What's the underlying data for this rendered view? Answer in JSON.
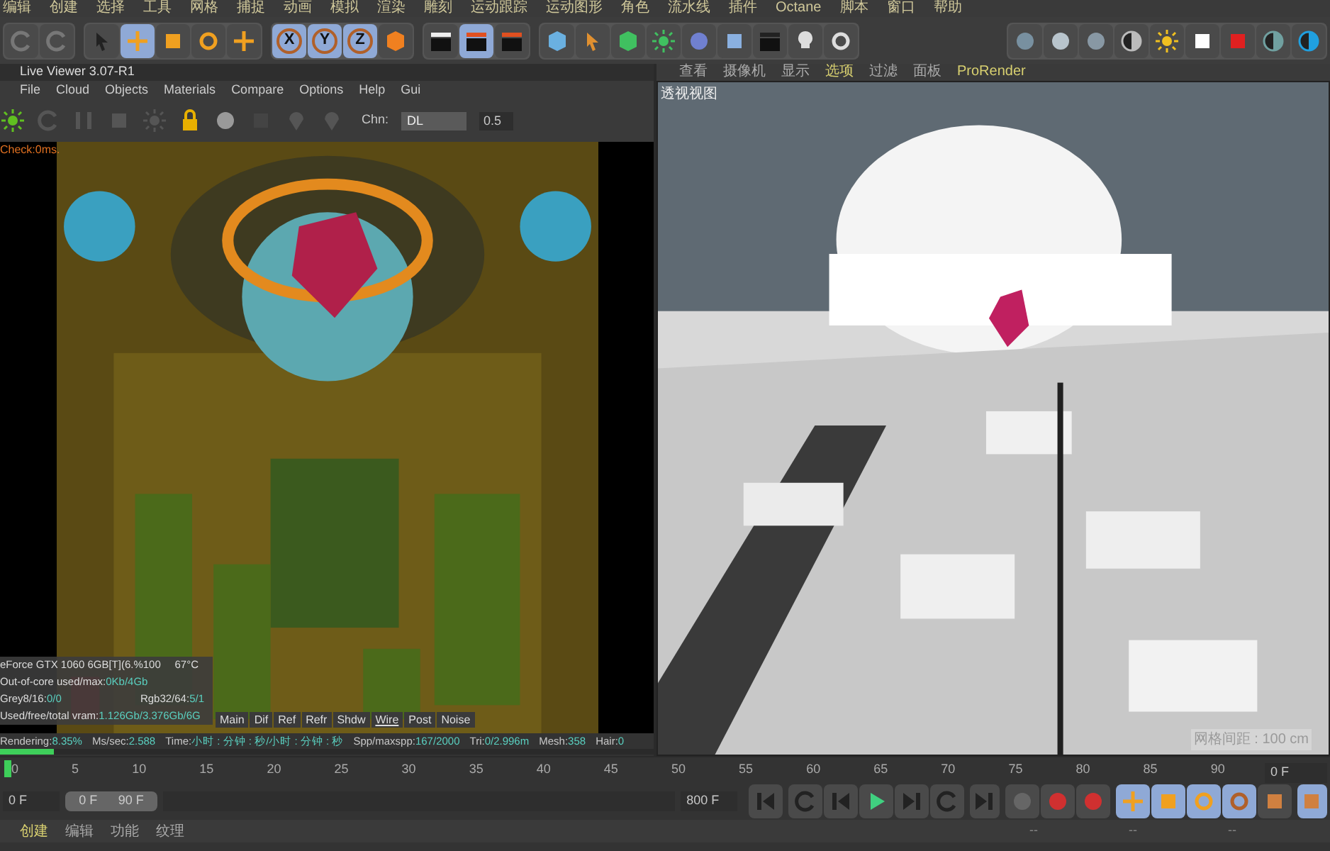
{
  "menu_bar": [
    "编辑",
    "创建",
    "选择",
    "工具",
    "网格",
    "捕捉",
    "动画",
    "模拟",
    "渲染",
    "雕刻",
    "运动跟踪",
    "运动图形",
    "角色",
    "流水线",
    "插件",
    "Octane",
    "脚本",
    "窗口",
    "帮助"
  ],
  "tools": [
    {
      "selected": false
    },
    {
      "selected": true
    },
    {
      "selected": false
    },
    {
      "selected": false
    },
    {
      "selected": false
    }
  ],
  "axis_locks": [
    {
      "label": "X",
      "selected": true
    },
    {
      "label": "Y",
      "selected": true
    },
    {
      "label": "Z",
      "selected": true
    }
  ],
  "live_viewer": {
    "title": "Live Viewer 3.07-R1",
    "menu": [
      "File",
      "Cloud",
      "Objects",
      "Materials",
      "Compare",
      "Options",
      "Help",
      "Gui"
    ],
    "channel_label": "Chn:",
    "channel": "DL",
    "value": "0.5",
    "check": "Check:0ms.",
    "stats": [
      {
        "left": "eForce GTX 1060 6GB[T](6.%100",
        "right": "67°C"
      },
      {
        "left": "Out-of-core used/max:",
        "value": "0Kb/4Gb"
      },
      {
        "left": "Grey8/16: ",
        "value": "0/0",
        "right": "Rgb32/64: ",
        "right_value": "5/1"
      },
      {
        "left": "Used/free/total vram: ",
        "value": "1.126Gb/3.376Gb/6G"
      }
    ],
    "passes": [
      {
        "label": "Main",
        "selected": false
      },
      {
        "label": "Dif",
        "selected": false
      },
      {
        "label": "Ref",
        "selected": false
      },
      {
        "label": "Refr",
        "selected": false
      },
      {
        "label": "Shdw",
        "selected": false
      },
      {
        "label": "Wire",
        "selected": true
      },
      {
        "label": "Post",
        "selected": false
      },
      {
        "label": "Noise",
        "selected": false
      }
    ],
    "status": [
      {
        "label": "Rendering: ",
        "value": "8.35%"
      },
      {
        "label": "Ms/sec: ",
        "value": "2.588"
      },
      {
        "label": "Time: ",
        "value": "小时 : 分钟 : 秒/小时 : 分钟 : 秒"
      },
      {
        "label": "Spp/maxspp: ",
        "value": "167/2000"
      },
      {
        "label": "Tri: ",
        "value": "0/2.996m"
      },
      {
        "label": "Mesh: ",
        "value": "358"
      },
      {
        "label": "Hair: ",
        "value": "0"
      }
    ],
    "progress": {
      "level": 0.0835
    }
  },
  "viewport": {
    "menu": [
      {
        "label": "查看",
        "selected": false
      },
      {
        "label": "摄像机",
        "selected": false
      },
      {
        "label": "显示",
        "selected": false
      },
      {
        "label": "选项",
        "selected": true
      },
      {
        "label": "过滤",
        "selected": false
      },
      {
        "label": "面板",
        "selected": false
      },
      {
        "label": "ProRender",
        "selected": true
      }
    ],
    "label": "透视视图",
    "grid_spacing": "网格间距 : 100 cm"
  },
  "timeline": {
    "ticks": [
      "0",
      "5",
      "10",
      "15",
      "20",
      "25",
      "30",
      "35",
      "40",
      "45",
      "50",
      "55",
      "60",
      "65",
      "70",
      "75",
      "80",
      "85",
      "90"
    ],
    "current_frame": "0 F",
    "start": "0 F",
    "range_start": "0 F",
    "range_end": "90 F",
    "end": "800 F"
  },
  "bottom_menu": [
    {
      "label": "创建",
      "selected": true
    },
    {
      "label": "编辑",
      "selected": false
    },
    {
      "label": "功能",
      "selected": false
    },
    {
      "label": "纹理",
      "selected": false
    }
  ],
  "attributes": [
    "--",
    "--",
    "--"
  ]
}
